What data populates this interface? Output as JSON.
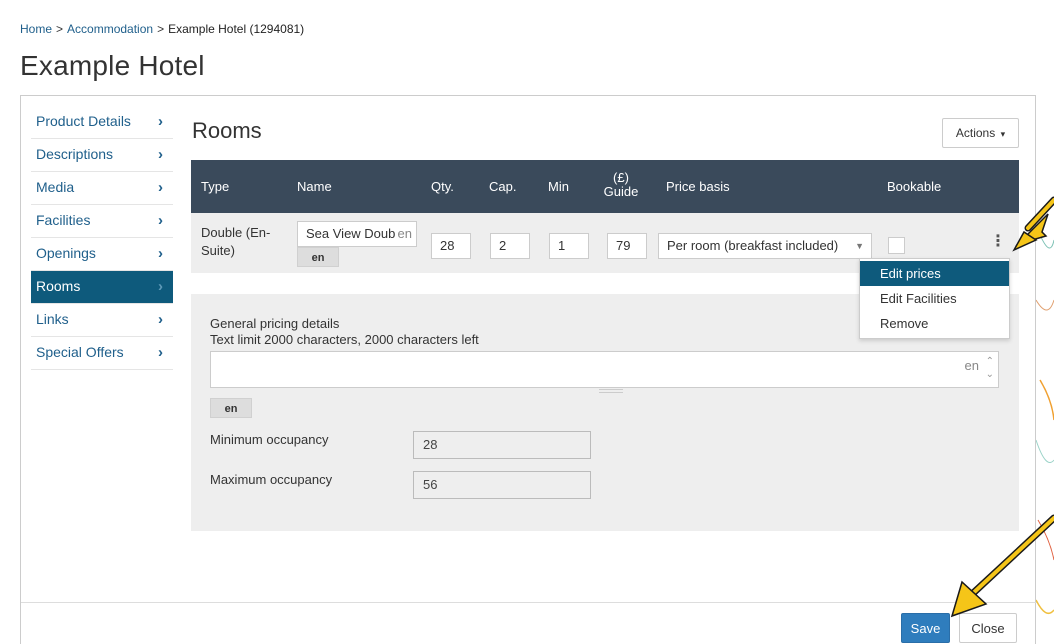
{
  "breadcrumb": {
    "home": "Home",
    "section": "Accommodation",
    "current": "Example Hotel (1294081)",
    "separator": ">"
  },
  "page_title": "Example Hotel",
  "sidebar": {
    "items": [
      {
        "label": "Product Details",
        "chevron": "›"
      },
      {
        "label": "Descriptions",
        "chevron": "›"
      },
      {
        "label": "Media",
        "chevron": "›"
      },
      {
        "label": "Facilities",
        "chevron": "›"
      },
      {
        "label": "Openings",
        "chevron": "›"
      },
      {
        "label": "Rooms",
        "chevron": "›",
        "active": true
      },
      {
        "label": "Links",
        "chevron": "›"
      },
      {
        "label": "Special Offers",
        "chevron": "›"
      }
    ]
  },
  "rooms": {
    "title": "Rooms",
    "actions_label": "Actions",
    "columns": {
      "type": "Type",
      "name": "Name",
      "qty": "Qty.",
      "cap": "Cap.",
      "min": "Min",
      "guide_top": "(£)",
      "guide_bottom": "Guide",
      "price_basis": "Price basis",
      "bookable": "Bookable"
    },
    "row": {
      "type_line1": "Double (En-",
      "type_line2": "Suite)",
      "name": "Sea View Double",
      "name_lang": "en",
      "lang_tab": "en",
      "qty": "28",
      "cap": "2",
      "min": "1",
      "guide": "79",
      "price_basis": "Per room (breakfast included)",
      "select_arrow": "▼",
      "kebab": "⋮"
    },
    "menu": {
      "items": [
        "Edit prices",
        "Edit Facilities",
        "Remove"
      ],
      "highlighted": "Edit prices"
    }
  },
  "pricing": {
    "heading": "General pricing details",
    "limit_text": "Text limit 2000 characters, 2000 characters left",
    "text_lang": "en",
    "lang_tab": "en",
    "min_occ_label": "Minimum occupancy",
    "min_occ_value": "28",
    "max_occ_label": "Maximum occupancy",
    "max_occ_value": "56"
  },
  "footer": {
    "save_label": "Save",
    "close_label": "Close"
  },
  "colors": {
    "accent": "#0e5a7c",
    "header": "#3a4a5b",
    "link": "#1f5f8b",
    "save": "#2f7dbd",
    "arrow": "#f5c518"
  }
}
